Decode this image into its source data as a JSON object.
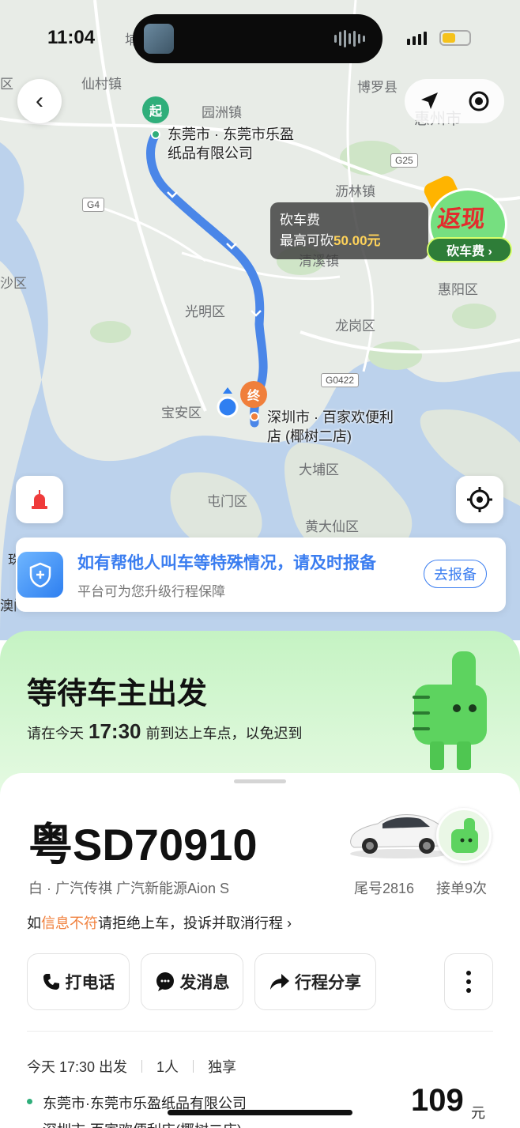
{
  "status_bar": {
    "time": "11:04"
  },
  "map": {
    "places": [
      {
        "name": "仙村镇"
      },
      {
        "name": "园洲镇"
      },
      {
        "name": "博罗县"
      },
      {
        "name": "惠州市"
      },
      {
        "name": "沥林镇"
      },
      {
        "name": "沙区"
      },
      {
        "name": "光明区"
      },
      {
        "name": "清溪镇"
      },
      {
        "name": "惠阳区"
      },
      {
        "name": "龙岗区"
      },
      {
        "name": "宝安区"
      },
      {
        "name": "大埔区"
      },
      {
        "name": "屯门区"
      },
      {
        "name": "黄大仙区"
      },
      {
        "name": "珠"
      },
      {
        "name": "澳门"
      },
      {
        "name": "区"
      },
      {
        "name": "埔"
      }
    ],
    "roads": [
      "G25",
      "G4",
      "G0422"
    ],
    "start_marker": "起",
    "end_marker": "终",
    "start_label": "东莞市 · 东莞市乐盈纸品有限公司",
    "end_label": "深圳市 · 百家欢便利店 (椰树二店)"
  },
  "promo": {
    "line1": "砍车费",
    "line2_prefix": "最高可砍",
    "line2_amount": "50.00元",
    "badge_big": "返现",
    "badge_pill": "砍车费 ›"
  },
  "safety": {
    "title": "如有帮他人叫车等特殊情况，请及时报备",
    "subtitle": "平台可为您升级行程保障",
    "button": "去报备"
  },
  "status_card": {
    "title": "等待车主出发",
    "sub_prefix": "请在今天",
    "time": "17:30",
    "sub_suffix": "前到达上车点，以免迟到"
  },
  "driver": {
    "plate": "粤SD70910",
    "car_desc": "白 · 广汽传祺 广汽新能源Aion S",
    "tail_no": "尾号2816",
    "orders": "接单9次",
    "warn_prefix": "如",
    "warn_highlight": "信息不符",
    "warn_suffix": "请拒绝上车，投诉并取消行程 ›"
  },
  "actions": {
    "call": "打电话",
    "message": "发消息",
    "share": "行程分享"
  },
  "trip": {
    "time": "今天 17:30 出发",
    "people": "1人",
    "type": "独享",
    "from": "东莞市·东莞市乐盈纸品有限公司",
    "to": "深圳市·百家欢便利店(椰树二店)",
    "price": "109",
    "price_unit": "元"
  },
  "colors": {
    "route": "#4a86e8",
    "start": "#2fae7a",
    "end": "#f07f3b",
    "accent_blue": "#3a7df0",
    "highlight": "#f07f3b",
    "status_green": "#c5f3c3"
  }
}
